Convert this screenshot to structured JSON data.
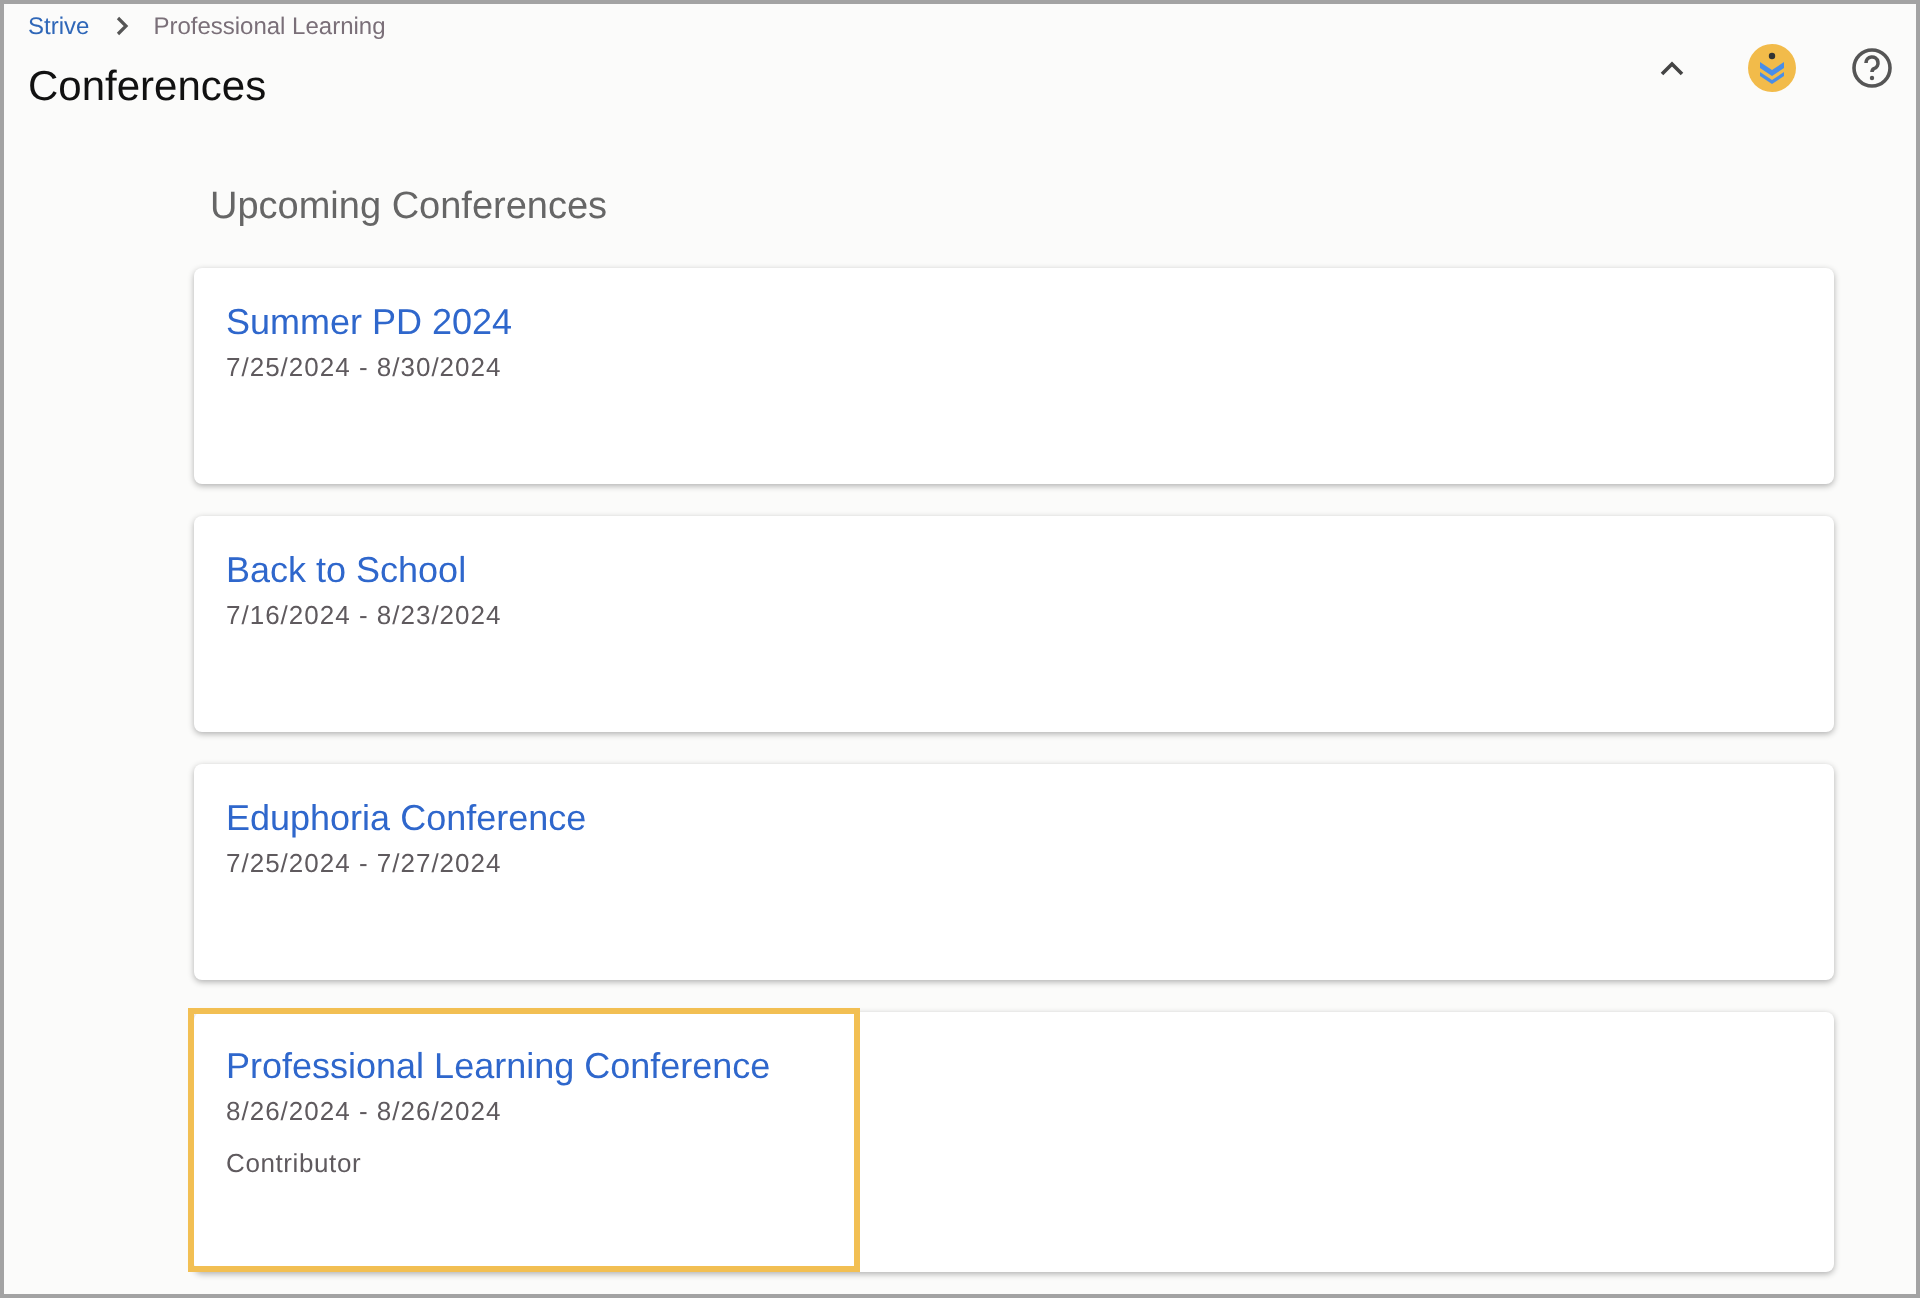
{
  "breadcrumb": [
    {
      "label": "Strive",
      "link": true
    },
    {
      "label": "Professional Learning",
      "link": false
    }
  ],
  "title": "Conferences",
  "section_title": "Upcoming Conferences",
  "conferences": [
    {
      "name": "Summer PD 2024",
      "dates": "7/25/2024 - 8/30/2024",
      "highlighted": false
    },
    {
      "name": "Back to School",
      "dates": "7/16/2024 - 8/23/2024",
      "highlighted": false
    },
    {
      "name": "Eduphoria Conference",
      "dates": "7/25/2024 - 7/27/2024",
      "highlighted": false
    },
    {
      "name": "Professional Learning Conference",
      "dates": "8/26/2024 - 8/26/2024",
      "role": "Contributor",
      "highlighted": true
    }
  ]
}
